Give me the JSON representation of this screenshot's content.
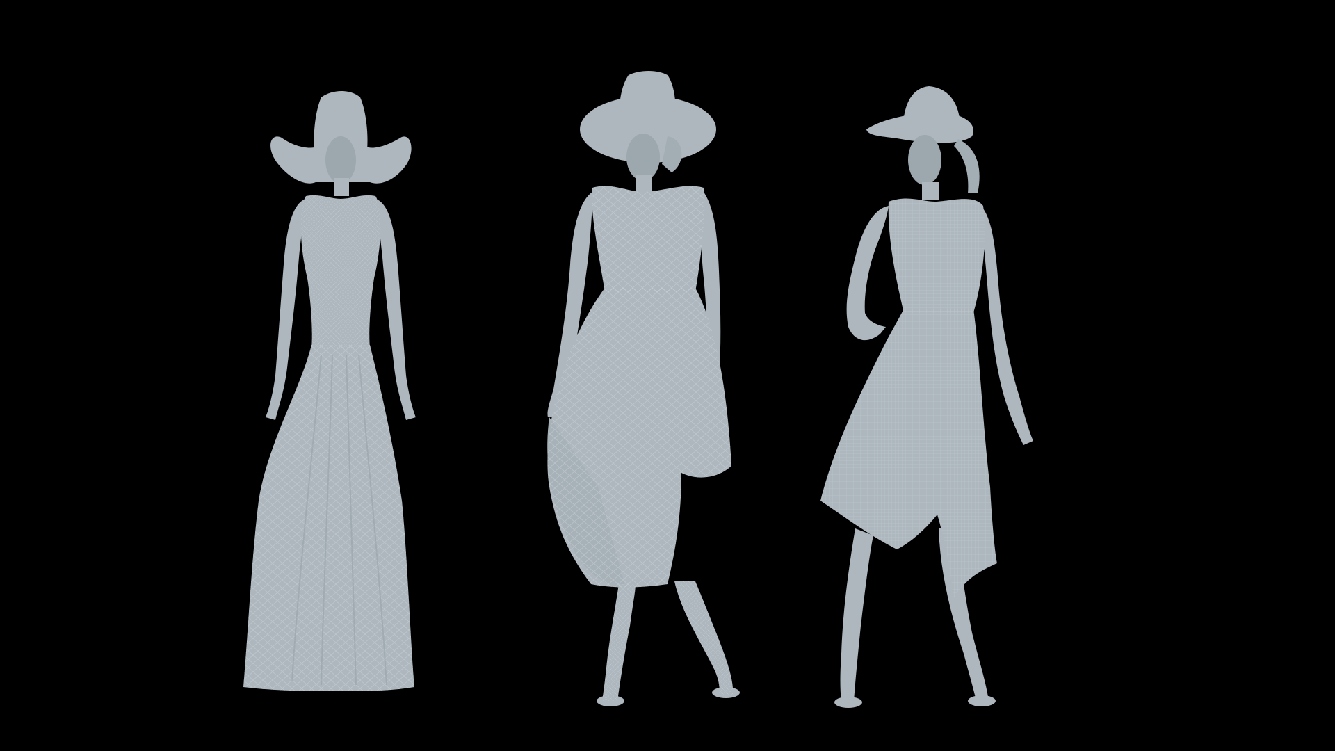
{
  "scene": {
    "background_color": "#000000",
    "figure_color": "#aeb7be",
    "figure_shadow_color": "#8f99a1",
    "wireframe_color": "#c9d0d5",
    "figures": [
      {
        "id": "figure-left",
        "description_name": "mannequin-long-gown-wide-hat"
      },
      {
        "id": "figure-center",
        "description_name": "mannequin-high-low-dress-hat"
      },
      {
        "id": "figure-right",
        "description_name": "mannequin-asymmetric-dress-hat"
      }
    ]
  }
}
